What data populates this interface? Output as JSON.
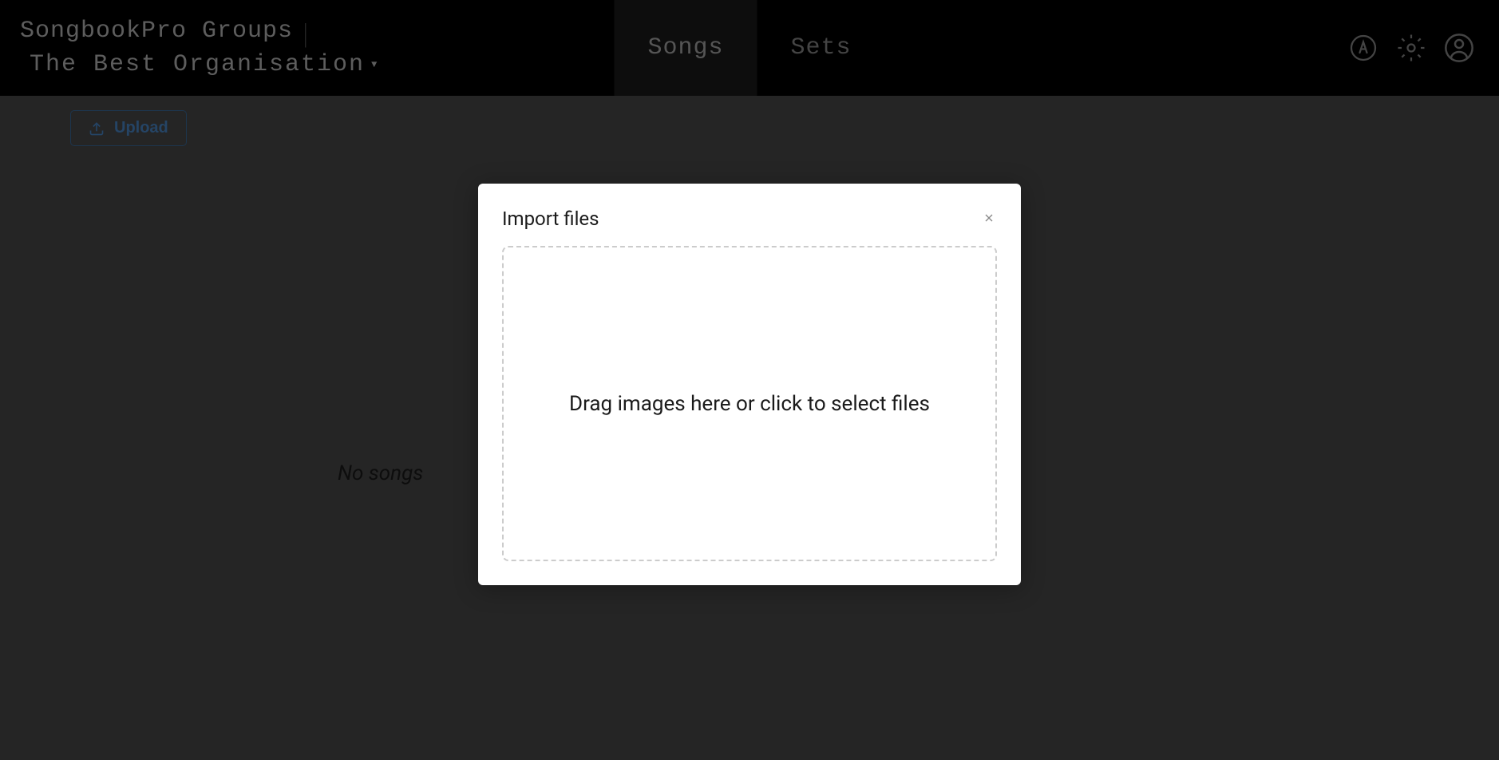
{
  "header": {
    "app_title": "SongbookPro Groups",
    "org_name": "The Best Organisation"
  },
  "nav": {
    "tabs": [
      {
        "label": "Songs",
        "active": true
      },
      {
        "label": "Sets",
        "active": false
      }
    ]
  },
  "toolbar": {
    "upload_label": "Upload"
  },
  "main": {
    "empty_state": "No songs"
  },
  "modal": {
    "title": "Import files",
    "dropzone_text": "Drag images here or click to select files"
  },
  "icons": {
    "auto": "auto-icon",
    "settings": "gear-icon",
    "account": "account-circle-icon",
    "upload": "upload-icon",
    "close": "close-icon",
    "caret": "caret-down-icon"
  }
}
